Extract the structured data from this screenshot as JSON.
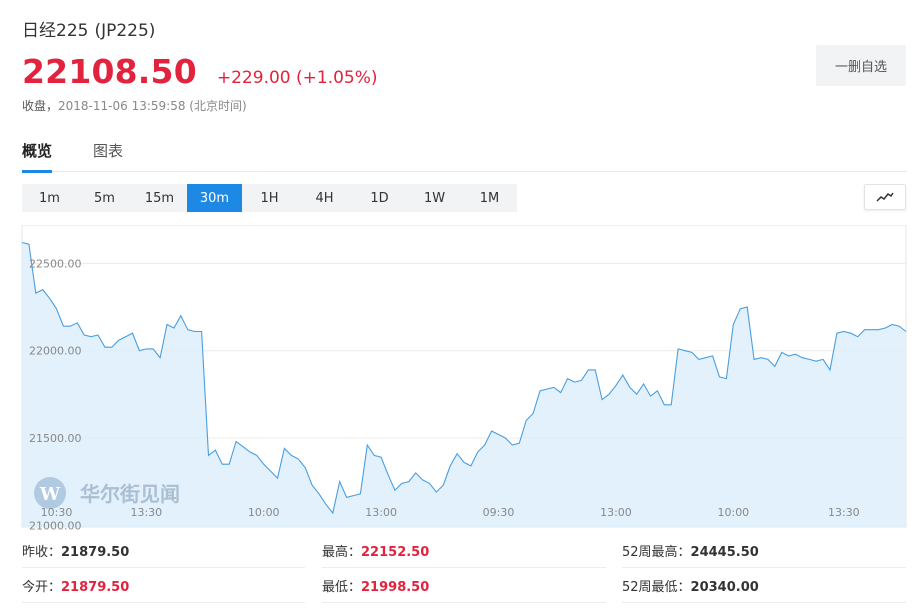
{
  "header": {
    "name": "日经225",
    "code": "(JP225)",
    "price": "22108.50",
    "change": "+229.00 (+1.05%)",
    "close_label": "收盘，",
    "close_time": "2018-11-06 13:59:58 (北京时间)",
    "remove_button": "一删自选"
  },
  "tabs": [
    {
      "label": "概览",
      "active": true
    },
    {
      "label": "图表",
      "active": false
    }
  ],
  "periods": [
    "1m",
    "5m",
    "15m",
    "30m",
    "1H",
    "4H",
    "1D",
    "1W",
    "1M"
  ],
  "active_period": "30m",
  "watermark": "华尔街见闻",
  "colors": {
    "up": "#e2233e",
    "accent": "#1e88e5",
    "line": "#4a9ee0",
    "area": "#ddeefb"
  },
  "chart_data": {
    "type": "area",
    "ylim": [
      20990,
      22720
    ],
    "y_ticks": [
      21000.0,
      21500.0,
      22000.0,
      22500.0
    ],
    "y_tick_labels": [
      "21000.00",
      "21500.00",
      "22000.00",
      "22500.00"
    ],
    "x_tick_labels": [
      "10:30",
      "13:30",
      "10:00",
      "13:00",
      "09:30",
      "13:00",
      "10:00",
      "13:30"
    ],
    "x_tick_index": [
      5,
      18,
      35,
      52,
      69,
      86,
      103,
      119
    ],
    "grid": true,
    "values": [
      22620,
      22610,
      22330,
      22350,
      22300,
      22240,
      22140,
      22140,
      22160,
      22090,
      22080,
      22090,
      22020,
      22020,
      22060,
      22080,
      22100,
      22000,
      22010,
      22010,
      21960,
      22150,
      22130,
      22200,
      22120,
      22110,
      22110,
      21400,
      21430,
      21350,
      21350,
      21480,
      21450,
      21420,
      21400,
      21350,
      21310,
      21270,
      21440,
      21400,
      21380,
      21330,
      21230,
      21180,
      21120,
      21070,
      21250,
      21160,
      21170,
      21180,
      21460,
      21400,
      21390,
      21290,
      21200,
      21240,
      21250,
      21300,
      21260,
      21240,
      21190,
      21230,
      21340,
      21410,
      21360,
      21340,
      21420,
      21460,
      21540,
      21520,
      21500,
      21460,
      21470,
      21600,
      21640,
      21770,
      21780,
      21790,
      21760,
      21840,
      21820,
      21830,
      21890,
      21890,
      21720,
      21750,
      21800,
      21860,
      21790,
      21750,
      21810,
      21740,
      21770,
      21690,
      21690,
      22010,
      22000,
      21990,
      21950,
      21960,
      21970,
      21850,
      21840,
      22150,
      22240,
      22250,
      21950,
      21960,
      21950,
      21910,
      21990,
      21970,
      21980,
      21960,
      21950,
      21940,
      21950,
      21890,
      22100,
      22110,
      22100,
      22080,
      22120,
      22120,
      22120,
      22130,
      22150,
      22140,
      22110
    ]
  },
  "stats": [
    {
      "label": "昨收：",
      "value": "21879.50",
      "red": false
    },
    {
      "label": "最高：",
      "value": "22152.50",
      "red": true
    },
    {
      "label": "52周最高：",
      "value": "24445.50",
      "red": false
    },
    {
      "label": "今开：",
      "value": "21879.50",
      "red": true
    },
    {
      "label": "最低：",
      "value": "21998.50",
      "red": true
    },
    {
      "label": "52周最低：",
      "value": "20340.00",
      "red": false
    }
  ]
}
